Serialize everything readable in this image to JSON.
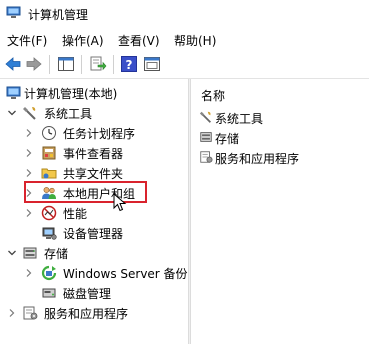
{
  "window": {
    "title": "计算机管理"
  },
  "menu": [
    "文件(F)",
    "操作(A)",
    "查看(V)",
    "帮助(H)"
  ],
  "toolbar": {
    "buttons": [
      "back-arrow-icon",
      "forward-arrow-icon",
      "show-hide-tree-icon",
      "export-list-icon",
      "help-icon",
      "properties-icon"
    ]
  },
  "tree": {
    "root": "计算机管理(本地)",
    "system_tools": "系统工具",
    "task_scheduler": "任务计划程序",
    "event_viewer": "事件查看器",
    "shared_folders": "共享文件夹",
    "local_users_groups": "本地用户和组",
    "performance": "性能",
    "device_manager": "设备管理器",
    "storage": "存储",
    "windows_server_backup": "Windows Server 备份",
    "disk_management": "磁盘管理",
    "services_apps": "服务和应用程序"
  },
  "right": {
    "column_header": "名称",
    "items": [
      "系统工具",
      "存储",
      "服务和应用程序"
    ]
  },
  "colors": {
    "highlight_box": "#d9232d"
  }
}
